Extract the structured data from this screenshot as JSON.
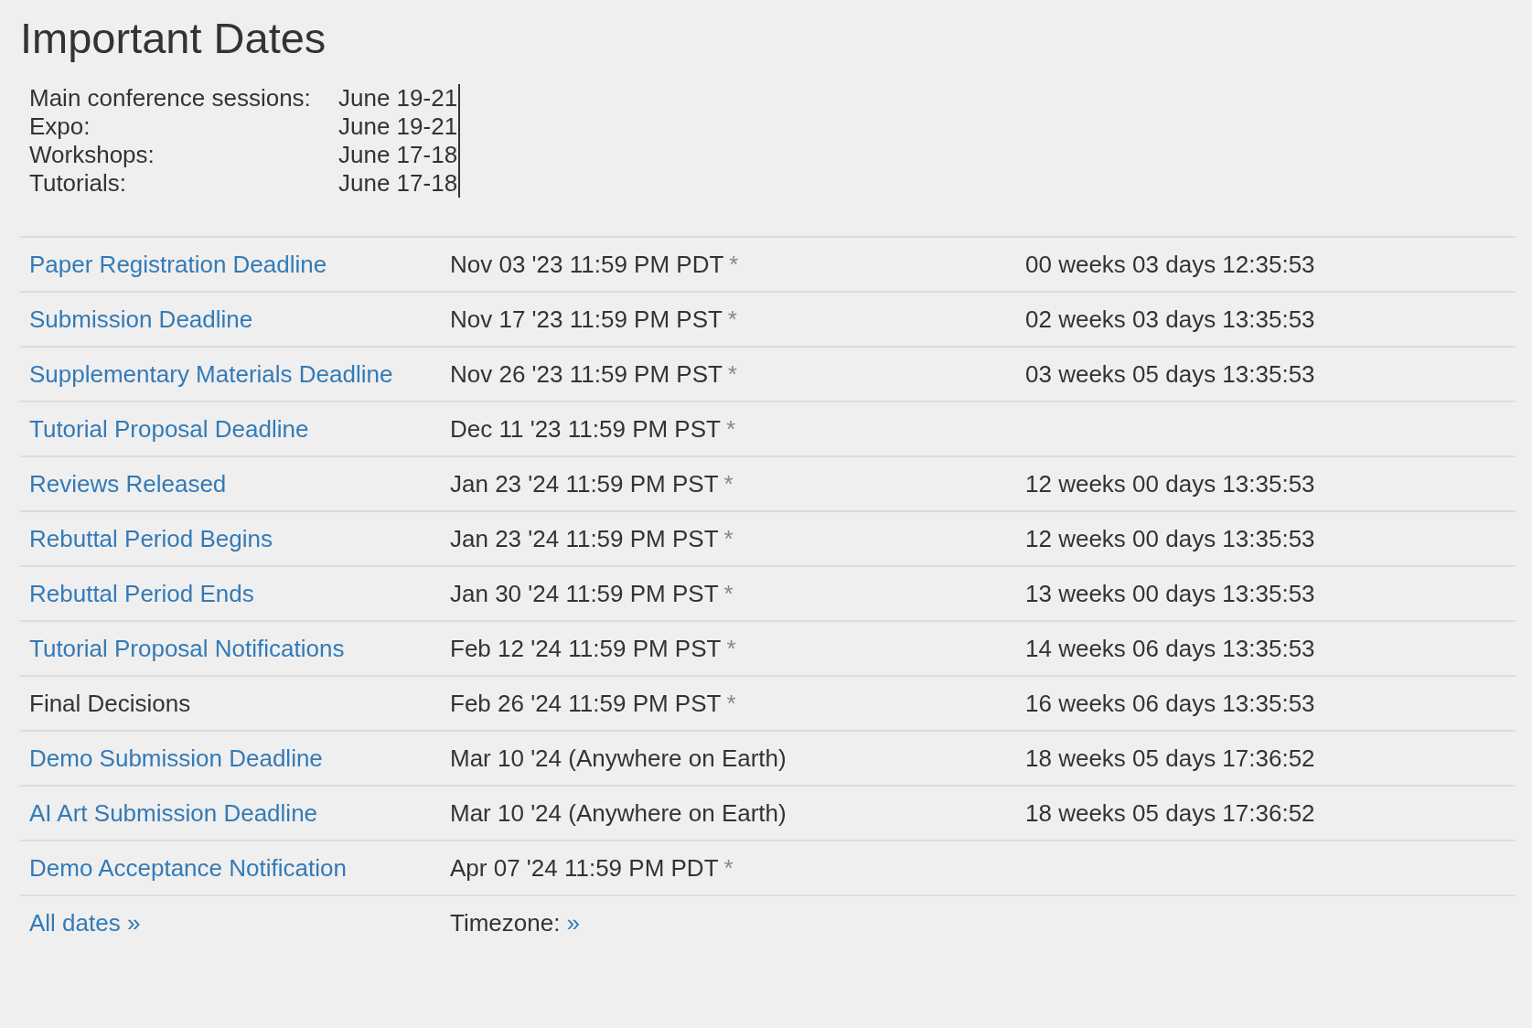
{
  "title": "Important Dates",
  "summary": [
    {
      "label": "Main conference sessions:",
      "value": "June 19-21"
    },
    {
      "label": "Expo:",
      "value": "June 19-21"
    },
    {
      "label": "Workshops:",
      "value": "June 17-18"
    },
    {
      "label": "Tutorials:",
      "value": "June 17-18"
    }
  ],
  "dates": [
    {
      "name": "Paper Registration Deadline",
      "linked": true,
      "date": "Nov 03 '23 11:59 PM PDT",
      "note": "*",
      "countdown": "00 weeks 03 days 12:35:53"
    },
    {
      "name": "Submission Deadline",
      "linked": true,
      "date": "Nov 17 '23 11:59 PM PST",
      "note": "*",
      "countdown": "02 weeks 03 days 13:35:53"
    },
    {
      "name": "Supplementary Materials Deadline",
      "linked": true,
      "date": "Nov 26 '23 11:59 PM PST",
      "note": "*",
      "countdown": "03 weeks 05 days 13:35:53"
    },
    {
      "name": "Tutorial Proposal Deadline",
      "linked": true,
      "date": "Dec 11 '23 11:59 PM PST",
      "note": "*"
    },
    {
      "name": "Reviews Released",
      "linked": true,
      "date": "Jan 23 '24 11:59 PM PST",
      "note": "*",
      "countdown": "12 weeks 00 days 13:35:53"
    },
    {
      "name": "Rebuttal Period Begins",
      "linked": true,
      "date": "Jan 23 '24 11:59 PM PST",
      "note": "*",
      "countdown": "12 weeks 00 days 13:35:53"
    },
    {
      "name": "Rebuttal Period Ends",
      "linked": true,
      "date": "Jan 30 '24 11:59 PM PST",
      "note": "*",
      "countdown": "13 weeks 00 days 13:35:53"
    },
    {
      "name": "Tutorial Proposal Notifications",
      "linked": true,
      "date": "Feb 12 '24 11:59 PM PST",
      "note": "*",
      "countdown": "14 weeks 06 days 13:35:53"
    },
    {
      "name": "Final Decisions",
      "linked": false,
      "date": "Feb 26 '24 11:59 PM PST",
      "note": "*",
      "countdown": "16 weeks 06 days 13:35:53"
    },
    {
      "name": "Demo Submission Deadline",
      "linked": true,
      "date": "Mar 10 '24 (Anywhere on Earth)",
      "countdown": "18 weeks 05 days 17:36:52"
    },
    {
      "name": "AI Art Submission Deadline",
      "linked": true,
      "date": "Mar 10 '24 (Anywhere on Earth)",
      "countdown": "18 weeks 05 days 17:36:52"
    },
    {
      "name": "Demo Acceptance Notification",
      "linked": true,
      "date": "Apr 07 '24 11:59 PM PDT",
      "note": "*"
    }
  ],
  "footer": {
    "all_dates": "All dates »",
    "timezone_label": "Timezone:",
    "timezone_link": "»"
  }
}
